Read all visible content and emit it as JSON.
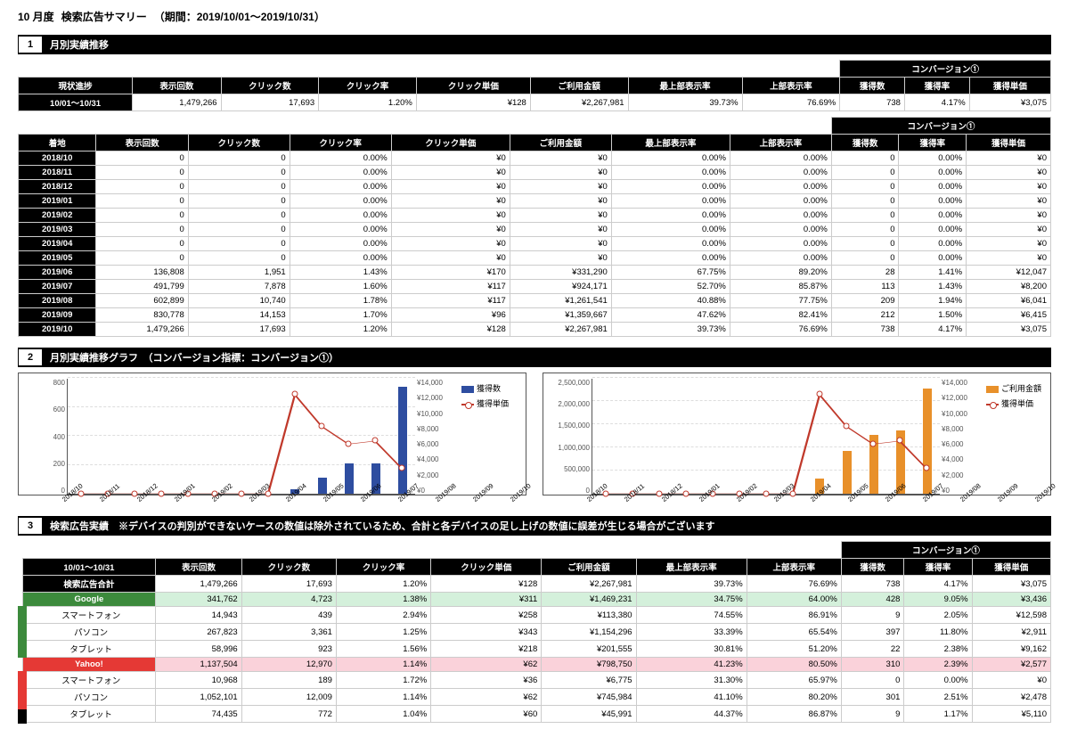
{
  "page_title_parts": {
    "month": "10 月度",
    "label": "検索広告サマリー",
    "period": "（期間：2019/10/01～2019/10/31）"
  },
  "sections": {
    "s1": {
      "num": "1",
      "label": "月別実績推移"
    },
    "s2": {
      "num": "2",
      "label": "月別実績推移グラフ　（コンバージョン指標：コンバージョン①）"
    },
    "s3": {
      "num": "3",
      "label": "検索広告実績　※デバイスの判別ができないケースの数値は除外されているため、合計と各デバイスの足し上げの数値に誤差が生じる場合がございます"
    }
  },
  "cols": {
    "conv_group": "コンバージョン①",
    "c0_progress": "現状進捗",
    "c0_landing": "着地",
    "c0_period": "10/01～10/31",
    "c1": "表示回数",
    "c2": "クリック数",
    "c3": "クリック率",
    "c4": "クリック単価",
    "c5": "ご利用金額",
    "c6": "最上部表示率",
    "c7": "上部表示率",
    "c8": "獲得数",
    "c9": "獲得率",
    "c10": "獲得単価"
  },
  "progress_row": {
    "period": "10/01～10/31",
    "cells": [
      "1,479,266",
      "17,693",
      "1.20%",
      "¥128",
      "¥2,267,981",
      "39.73%",
      "76.69%",
      "738",
      "4.17%",
      "¥3,075"
    ]
  },
  "monthly_rows": [
    {
      "m": "2018/10",
      "cells": [
        "0",
        "0",
        "0.00%",
        "¥0",
        "¥0",
        "0.00%",
        "0.00%",
        "0",
        "0.00%",
        "¥0"
      ]
    },
    {
      "m": "2018/11",
      "cells": [
        "0",
        "0",
        "0.00%",
        "¥0",
        "¥0",
        "0.00%",
        "0.00%",
        "0",
        "0.00%",
        "¥0"
      ]
    },
    {
      "m": "2018/12",
      "cells": [
        "0",
        "0",
        "0.00%",
        "¥0",
        "¥0",
        "0.00%",
        "0.00%",
        "0",
        "0.00%",
        "¥0"
      ]
    },
    {
      "m": "2019/01",
      "cells": [
        "0",
        "0",
        "0.00%",
        "¥0",
        "¥0",
        "0.00%",
        "0.00%",
        "0",
        "0.00%",
        "¥0"
      ]
    },
    {
      "m": "2019/02",
      "cells": [
        "0",
        "0",
        "0.00%",
        "¥0",
        "¥0",
        "0.00%",
        "0.00%",
        "0",
        "0.00%",
        "¥0"
      ]
    },
    {
      "m": "2019/03",
      "cells": [
        "0",
        "0",
        "0.00%",
        "¥0",
        "¥0",
        "0.00%",
        "0.00%",
        "0",
        "0.00%",
        "¥0"
      ]
    },
    {
      "m": "2019/04",
      "cells": [
        "0",
        "0",
        "0.00%",
        "¥0",
        "¥0",
        "0.00%",
        "0.00%",
        "0",
        "0.00%",
        "¥0"
      ]
    },
    {
      "m": "2019/05",
      "cells": [
        "0",
        "0",
        "0.00%",
        "¥0",
        "¥0",
        "0.00%",
        "0.00%",
        "0",
        "0.00%",
        "¥0"
      ]
    },
    {
      "m": "2019/06",
      "cells": [
        "136,808",
        "1,951",
        "1.43%",
        "¥170",
        "¥331,290",
        "67.75%",
        "89.20%",
        "28",
        "1.41%",
        "¥12,047"
      ]
    },
    {
      "m": "2019/07",
      "cells": [
        "491,799",
        "7,878",
        "1.60%",
        "¥117",
        "¥924,171",
        "52.70%",
        "85.87%",
        "113",
        "1.43%",
        "¥8,200"
      ]
    },
    {
      "m": "2019/08",
      "cells": [
        "602,899",
        "10,740",
        "1.78%",
        "¥117",
        "¥1,261,541",
        "40.88%",
        "77.75%",
        "209",
        "1.94%",
        "¥6,041"
      ]
    },
    {
      "m": "2019/09",
      "cells": [
        "830,778",
        "14,153",
        "1.70%",
        "¥96",
        "¥1,359,667",
        "47.62%",
        "82.41%",
        "212",
        "1.50%",
        "¥6,415"
      ]
    },
    {
      "m": "2019/10",
      "cells": [
        "1,479,266",
        "17,693",
        "1.20%",
        "¥128",
        "¥2,267,981",
        "39.73%",
        "76.69%",
        "738",
        "4.17%",
        "¥3,075"
      ]
    }
  ],
  "device_rows": [
    {
      "cls": "total",
      "label": "検索広告合計",
      "cells": [
        "1,479,266",
        "17,693",
        "1.20%",
        "¥128",
        "¥2,267,981",
        "39.73%",
        "76.69%",
        "738",
        "4.17%",
        "¥3,075"
      ]
    },
    {
      "cls": "google",
      "label": "Google",
      "cells": [
        "341,762",
        "4,723",
        "1.38%",
        "¥311",
        "¥1,469,231",
        "34.75%",
        "64.00%",
        "428",
        "9.05%",
        "¥3,436"
      ]
    },
    {
      "cls": "sub g",
      "label": "スマートフォン",
      "cells": [
        "14,943",
        "439",
        "2.94%",
        "¥258",
        "¥113,380",
        "74.55%",
        "86.91%",
        "9",
        "2.05%",
        "¥12,598"
      ]
    },
    {
      "cls": "sub g",
      "label": "パソコン",
      "cells": [
        "267,823",
        "3,361",
        "1.25%",
        "¥343",
        "¥1,154,296",
        "33.39%",
        "65.54%",
        "397",
        "11.80%",
        "¥2,911"
      ]
    },
    {
      "cls": "sub g",
      "label": "タブレット",
      "cells": [
        "58,996",
        "923",
        "1.56%",
        "¥218",
        "¥201,555",
        "30.81%",
        "51.20%",
        "22",
        "2.38%",
        "¥9,162"
      ]
    },
    {
      "cls": "yahoo",
      "label": "Yahoo!",
      "cells": [
        "1,137,504",
        "12,970",
        "1.14%",
        "¥62",
        "¥798,750",
        "41.23%",
        "80.50%",
        "310",
        "2.39%",
        "¥2,577"
      ]
    },
    {
      "cls": "sub y",
      "label": "スマートフォン",
      "cells": [
        "10,968",
        "189",
        "1.72%",
        "¥36",
        "¥6,775",
        "31.30%",
        "65.97%",
        "0",
        "0.00%",
        "¥0"
      ]
    },
    {
      "cls": "sub y",
      "label": "パソコン",
      "cells": [
        "1,052,101",
        "12,009",
        "1.14%",
        "¥62",
        "¥745,984",
        "41.10%",
        "80.20%",
        "301",
        "2.51%",
        "¥2,478"
      ]
    },
    {
      "cls": "sub y",
      "label": "タブレット",
      "cells": [
        "74,435",
        "772",
        "1.04%",
        "¥60",
        "¥45,991",
        "44.37%",
        "86.87%",
        "9",
        "1.17%",
        "¥5,110"
      ]
    }
  ],
  "chart_data": [
    {
      "type": "bar+line",
      "categories": [
        "2018/10",
        "2018/11",
        "2018/12",
        "2019/01",
        "2019/02",
        "2019/03",
        "2019/04",
        "2019/05",
        "2019/06",
        "2019/07",
        "2019/08",
        "2019/09",
        "2019/10"
      ],
      "series": [
        {
          "name": "獲得数",
          "kind": "bar",
          "axis": "left",
          "color": "#2e4da0",
          "values": [
            0,
            0,
            0,
            0,
            0,
            0,
            0,
            0,
            28,
            113,
            209,
            212,
            738
          ]
        },
        {
          "name": "獲得単価",
          "kind": "line",
          "axis": "right",
          "color": "#c0392b",
          "values": [
            0,
            0,
            0,
            0,
            0,
            0,
            0,
            0,
            12047,
            8200,
            6041,
            6415,
            3075
          ]
        }
      ],
      "ylim_left": [
        0,
        800
      ],
      "yticks_left": [
        0,
        200,
        400,
        600,
        800
      ],
      "ylim_right": [
        0,
        14000
      ],
      "yticks_right": [
        "¥0",
        "¥2,000",
        "¥4,000",
        "¥6,000",
        "¥8,000",
        "¥10,000",
        "¥12,000",
        "¥14,000"
      ],
      "legend": [
        "獲得数",
        "獲得単価"
      ]
    },
    {
      "type": "bar+line",
      "categories": [
        "2018/10",
        "2018/11",
        "2018/12",
        "2019/01",
        "2019/02",
        "2019/03",
        "2019/04",
        "2019/05",
        "2019/06",
        "2019/07",
        "2019/08",
        "2019/09",
        "2019/10"
      ],
      "series": [
        {
          "name": "ご利用金額",
          "kind": "bar",
          "axis": "left",
          "color": "#e8902a",
          "values": [
            0,
            0,
            0,
            0,
            0,
            0,
            0,
            0,
            331290,
            924171,
            1261541,
            1359667,
            2267981
          ]
        },
        {
          "name": "獲得単価",
          "kind": "line",
          "axis": "right",
          "color": "#c0392b",
          "values": [
            0,
            0,
            0,
            0,
            0,
            0,
            0,
            0,
            12047,
            8200,
            6041,
            6415,
            3075
          ]
        }
      ],
      "ylim_left": [
        0,
        2500000
      ],
      "yticks_left": [
        "0",
        "500,000",
        "1,000,000",
        "1,500,000",
        "2,000,000",
        "2,500,000"
      ],
      "ylim_right": [
        0,
        14000
      ],
      "yticks_right": [
        "¥0",
        "¥2,000",
        "¥4,000",
        "¥6,000",
        "¥8,000",
        "¥10,000",
        "¥12,000",
        "¥14,000"
      ],
      "legend": [
        "ご利用金額",
        "獲得単価"
      ]
    }
  ]
}
